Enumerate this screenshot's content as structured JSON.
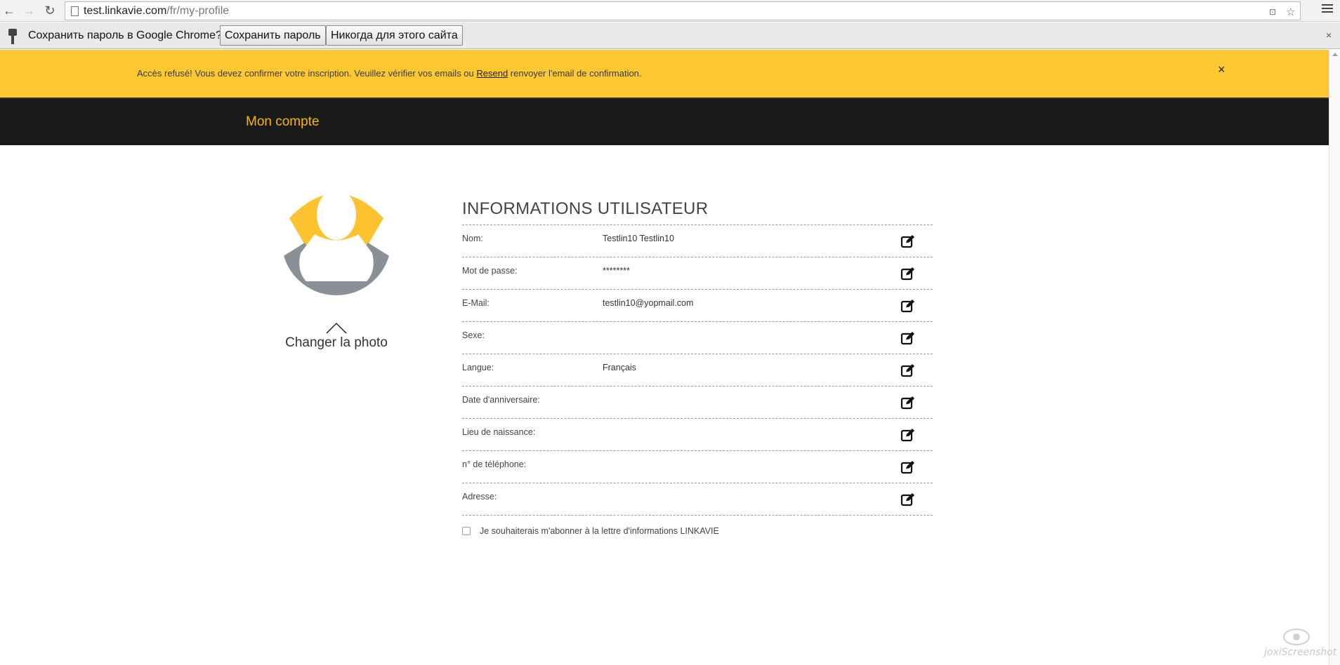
{
  "browser": {
    "url_host": "test.linkavie.com",
    "url_path": "/fr/my-profile"
  },
  "password_bar": {
    "prompt": "Сохранить пароль в Google Chrome?",
    "save_label": "Сохранить пароль",
    "never_label": "Никогда для этого сайта",
    "close": "×"
  },
  "alert": {
    "text_before": "Accès refusé! Vous devez confirmer votre inscription. Veuillez vérifier vos emails ou ",
    "link": "Resend",
    "text_after": " renvoyer l'email de confirmation.",
    "close": "×",
    "color": "#fdc832"
  },
  "header": {
    "title": "Mon compte",
    "accent": "#f5b800"
  },
  "profile": {
    "change_photo": "Changer la photo"
  },
  "info": {
    "title": "INFORMATIONS UTILISATEUR",
    "rows": [
      {
        "label": "Nom:",
        "value": "Testlin10 Testlin10"
      },
      {
        "label": "Mot de passe:",
        "value": "********"
      },
      {
        "label": "E-Mail:",
        "value": "testlin10@yopmail.com"
      },
      {
        "label": "Sexe:",
        "value": ""
      },
      {
        "label": "Langue:",
        "value": "Français"
      },
      {
        "label": "Date d'anniversaire:",
        "value": ""
      },
      {
        "label": "Lieu de naissance:",
        "value": ""
      },
      {
        "label": "n° de téléphone:",
        "value": ""
      },
      {
        "label": "Adresse:",
        "value": ""
      }
    ],
    "newsletter": "Je souhaiterais m'abonner à la lettre d'informations LINKAVIE"
  },
  "watermark": "joxiScreenshot"
}
